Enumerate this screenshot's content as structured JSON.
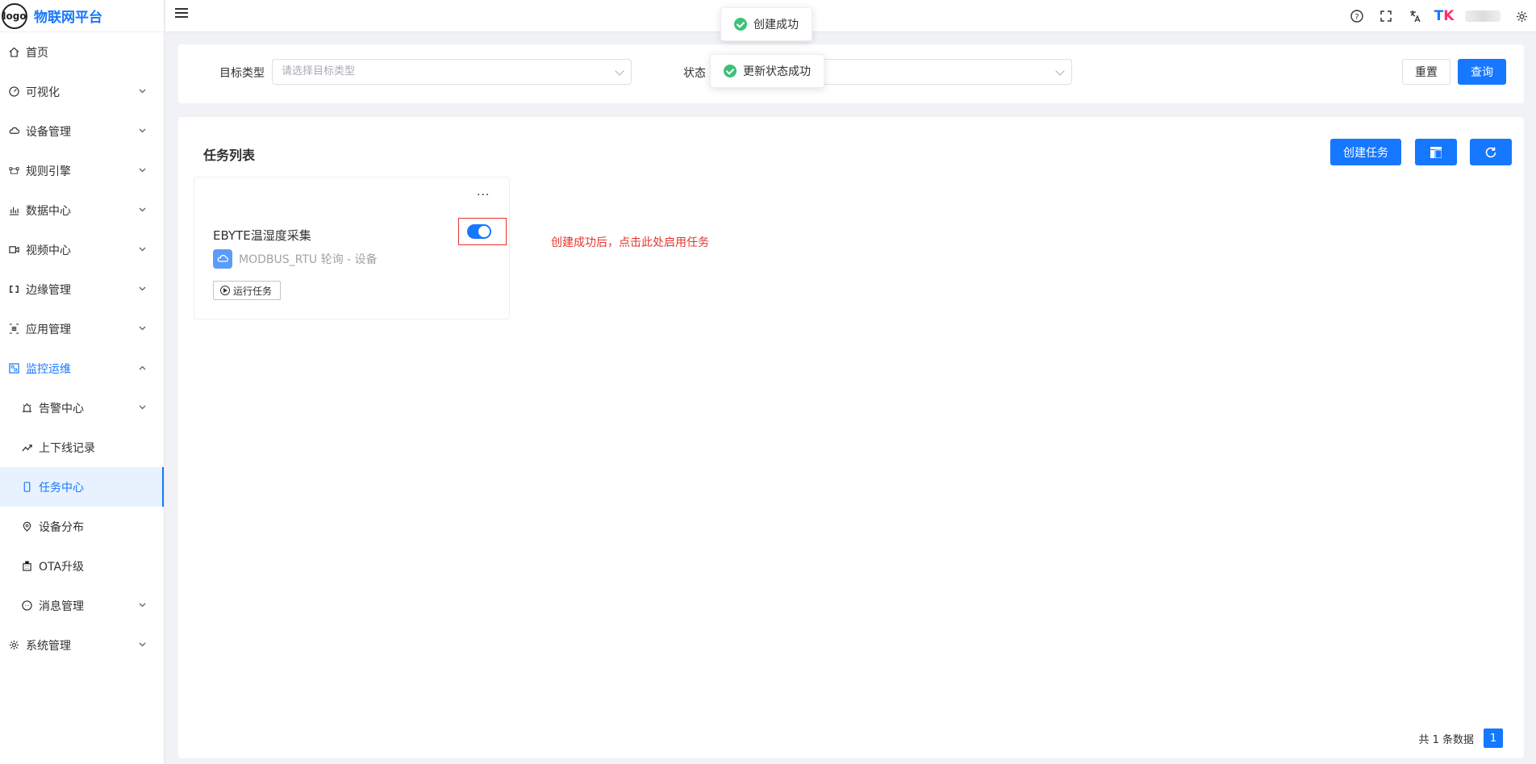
{
  "brand": {
    "logo_text": "logo",
    "title": "物联网平台"
  },
  "sidebar": {
    "items": [
      {
        "label": "首页",
        "icon": "home-icon"
      },
      {
        "label": "可视化",
        "icon": "dashboard-icon",
        "arrow": "down"
      },
      {
        "label": "设备管理",
        "icon": "cloud-icon",
        "arrow": "down"
      },
      {
        "label": "规则引擎",
        "icon": "rule-icon",
        "arrow": "down"
      },
      {
        "label": "数据中心",
        "icon": "chart-icon",
        "arrow": "down"
      },
      {
        "label": "视频中心",
        "icon": "video-icon",
        "arrow": "down"
      },
      {
        "label": "边缘管理",
        "icon": "edge-icon",
        "arrow": "down"
      },
      {
        "label": "应用管理",
        "icon": "app-icon",
        "arrow": "down"
      },
      {
        "label": "监控运维",
        "icon": "monitor-icon",
        "arrow": "up",
        "open": true
      },
      {
        "label": "告警中心",
        "icon": "alarm-icon",
        "arrow": "down",
        "sub": true
      },
      {
        "label": "上下线记录",
        "icon": "trend-icon",
        "sub": true
      },
      {
        "label": "任务中心",
        "icon": "phone-icon",
        "sub": true,
        "active": true
      },
      {
        "label": "设备分布",
        "icon": "location-icon",
        "sub": true
      },
      {
        "label": "OTA升级",
        "icon": "building-icon",
        "sub": true
      },
      {
        "label": "消息管理",
        "icon": "message-icon",
        "arrow": "down",
        "sub": true
      },
      {
        "label": "系统管理",
        "icon": "gear-icon",
        "arrow": "down"
      }
    ]
  },
  "search": {
    "target_type_label": "目标类型",
    "target_type_placeholder": "请选择目标类型",
    "status_label": "状态",
    "reset_label": "重置",
    "query_label": "查询"
  },
  "main": {
    "title": "任务列表",
    "create_label": "创建任务"
  },
  "task": {
    "more": "···",
    "name": "EBYTE温湿度采集",
    "protocol": "MODBUS_RTU 轮询 - 设备",
    "run_label": "运行任务",
    "enabled": true
  },
  "annotation": "创建成功后，点击此处启用任务",
  "pagination": {
    "total_text": "共 1 条数据",
    "current_page": "1"
  },
  "toasts": {
    "created": "创建成功",
    "status_updated": "更新状态成功"
  },
  "colors": {
    "primary": "#1677ff",
    "annotation": "#e5342c",
    "success": "#3ec07a"
  }
}
